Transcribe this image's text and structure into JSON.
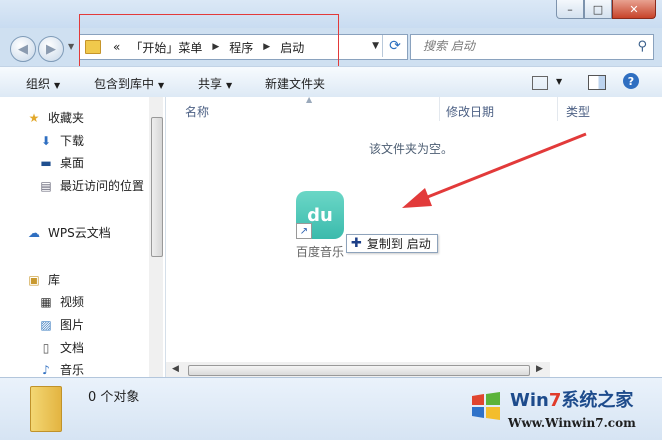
{
  "window": {
    "minimize": "–",
    "maximize": "□",
    "close": "✕"
  },
  "nav": {
    "back_icon": "back-arrow",
    "forward_icon": "forward-arrow"
  },
  "address": {
    "chevron": "«",
    "crumbs": [
      "「开始」菜单",
      "程序",
      "启动"
    ]
  },
  "search": {
    "placeholder": "搜索 启动"
  },
  "toolbar": {
    "organize": "组织",
    "include_library": "包含到库中",
    "share": "共享",
    "new_folder": "新建文件夹"
  },
  "sidebar": {
    "favorites": "收藏夹",
    "downloads": "下载",
    "desktop": "桌面",
    "recent": "最近访问的位置",
    "wps": "WPS云文档",
    "libraries": "库",
    "videos": "视频",
    "pictures": "图片",
    "documents": "文档",
    "music": "音乐"
  },
  "columns": {
    "name": "名称",
    "date": "修改日期",
    "type": "类型"
  },
  "content": {
    "empty_message": "该文件夹为空。",
    "dragged_item_label": "百度音乐",
    "app_icon_text": "du",
    "copy_tooltip": "复制到 启动"
  },
  "details": {
    "count": "0 个对象"
  },
  "watermark": {
    "brand_prefix": "Win",
    "brand_seven": "7",
    "brand_suffix": "系统之家",
    "url": "Www.Winwin7.com"
  },
  "colors": {
    "accent": "#2f6fc1",
    "annotation_red": "#e23a3a",
    "app_teal": "#2bb5a6"
  }
}
